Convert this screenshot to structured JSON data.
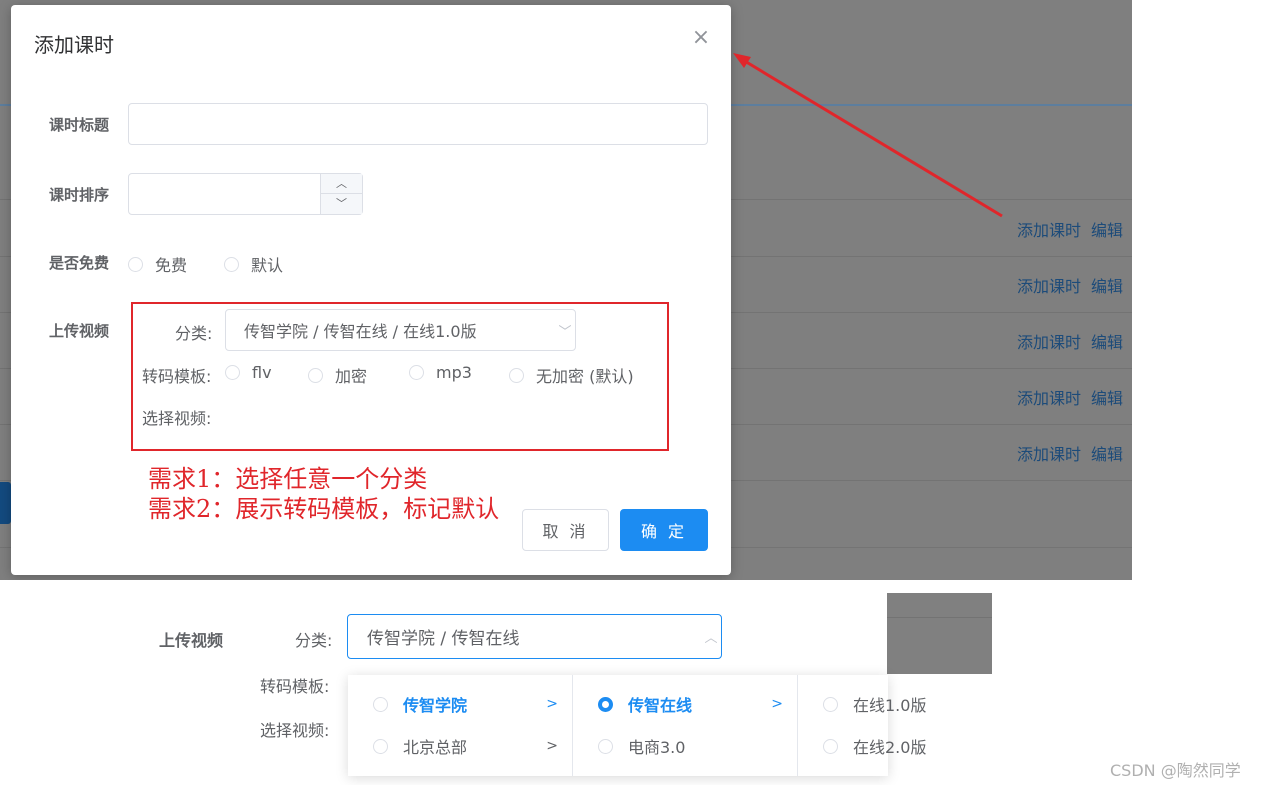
{
  "background": {
    "row_actions": [
      {
        "add": "添加课时",
        "edit": "编辑"
      },
      {
        "add": "添加课时",
        "edit": "编辑"
      },
      {
        "add": "添加课时",
        "edit": "编辑"
      },
      {
        "add": "添加课时",
        "edit": "编辑"
      },
      {
        "add": "添加课时",
        "edit": "编辑"
      }
    ]
  },
  "dialog": {
    "title": "添加课时",
    "close_icon": "close-icon",
    "fields": {
      "title_label": "课时标题",
      "title_value": "",
      "sort_label": "课时排序",
      "sort_value": "",
      "free_label": "是否免费",
      "free_options": [
        "免费",
        "默认"
      ],
      "upload_label": "上传视频"
    },
    "upload": {
      "category_label": "分类:",
      "category_value": "传智学院 / 传智在线 / 在线1.0版",
      "template_label": "转码模板:",
      "template_options": [
        "flv",
        "加密",
        "mp3",
        "无加密 (默认)"
      ],
      "video_label": "选择视频:"
    },
    "buttons": {
      "cancel": "取 消",
      "confirm": "确 定"
    }
  },
  "annotation": {
    "requirement_1": "需求1：选择任意一个分类",
    "requirement_2": "需求2：展示转码模板，标记默认",
    "color": "#e0262b"
  },
  "bottom": {
    "upload_label": "上传视频",
    "category_label": "分类:",
    "category_value": "传智学院 / 传智在线",
    "template_label": "转码模板:",
    "video_label": "选择视频:",
    "cascader": {
      "col1": [
        {
          "label": "传智学院",
          "active": true
        },
        {
          "label": "北京总部",
          "active": false
        }
      ],
      "col2": [
        {
          "label": "传智在线",
          "active": true,
          "checked": true
        },
        {
          "label": "电商3.0",
          "active": false
        }
      ],
      "col3": [
        {
          "label": "在线1.0版"
        },
        {
          "label": "在线2.0版"
        }
      ]
    }
  },
  "watermark": "CSDN @陶然同学",
  "colors": {
    "primary": "#1c8cf2",
    "border": "#dcdfe6",
    "overlay": "#808080"
  }
}
